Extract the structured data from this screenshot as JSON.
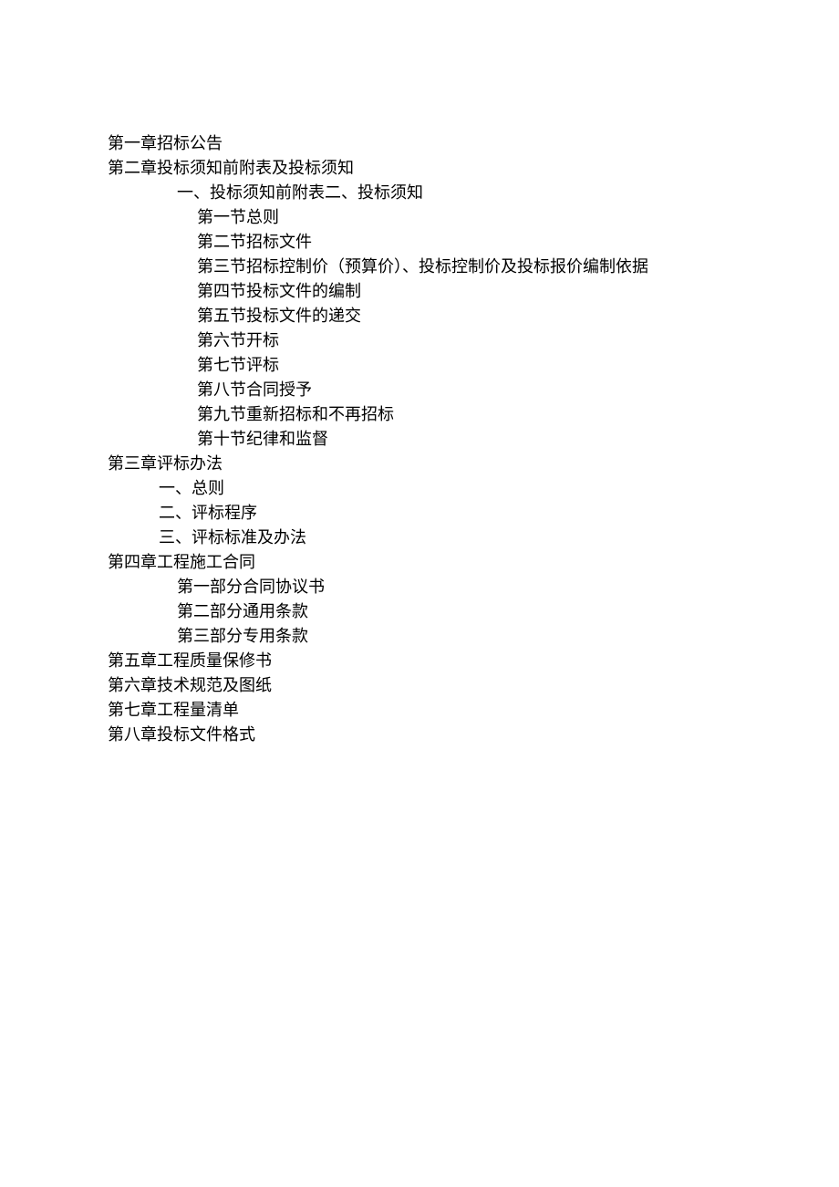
{
  "toc": {
    "ch1": "第一章招标公告",
    "ch2": "第二章投标须知前附表及投标须知",
    "ch2_sub1": "一、投标须知前附表二、投标须知",
    "ch2_s1": "第一节总则",
    "ch2_s2": "第二节招标文件",
    "ch2_s3": "第三节招标控制价（预算价）、投标控制价及投标报价编制依据",
    "ch2_s4": "第四节投标文件的编制",
    "ch2_s5": "第五节投标文件的递交",
    "ch2_s6": "第六节开标",
    "ch2_s7": "第七节评标",
    "ch2_s8": "第八节合同授予",
    "ch2_s9": "第九节重新招标和不再招标",
    "ch2_s10": "第十节纪律和监督",
    "ch3": "第三章评标办法",
    "ch3_s1": "一、总则",
    "ch3_s2": "二、评标程序",
    "ch3_s3": "三、评标标准及办法",
    "ch4": "第四章工程施工合同",
    "ch4_s1": "第一部分合同协议书",
    "ch4_s2": "第二部分通用条款",
    "ch4_s3": "第三部分专用条款",
    "ch5": "第五章工程质量保修书",
    "ch6": "第六章技术规范及图纸",
    "ch7": "第七章工程量清单",
    "ch8": "第八章投标文件格式"
  }
}
